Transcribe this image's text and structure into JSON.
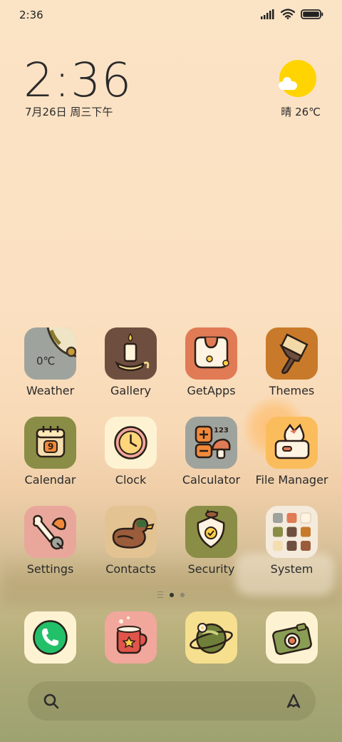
{
  "status_bar": {
    "time": "2:36"
  },
  "clock_widget": {
    "time": "2:36",
    "date": "7月26日 周三下午"
  },
  "weather_widget": {
    "text": "晴 26℃"
  },
  "apps": [
    {
      "label": "Weather",
      "badge": "0℃"
    },
    {
      "label": "Gallery"
    },
    {
      "label": "GetApps"
    },
    {
      "label": "Themes"
    },
    {
      "label": "Calendar",
      "badge": "9"
    },
    {
      "label": "Clock"
    },
    {
      "label": "Calculator",
      "badge": "123"
    },
    {
      "label": "File Manager"
    },
    {
      "label": "Settings"
    },
    {
      "label": "Contacts"
    },
    {
      "label": "Security"
    },
    {
      "label": "System"
    }
  ],
  "dock": [
    "phone",
    "messaging",
    "browser",
    "camera"
  ],
  "page_indicator": {
    "pages": 2,
    "current": 1
  },
  "colors": {
    "accent_sun": "#ffd400",
    "background": "#fbe3c5"
  }
}
